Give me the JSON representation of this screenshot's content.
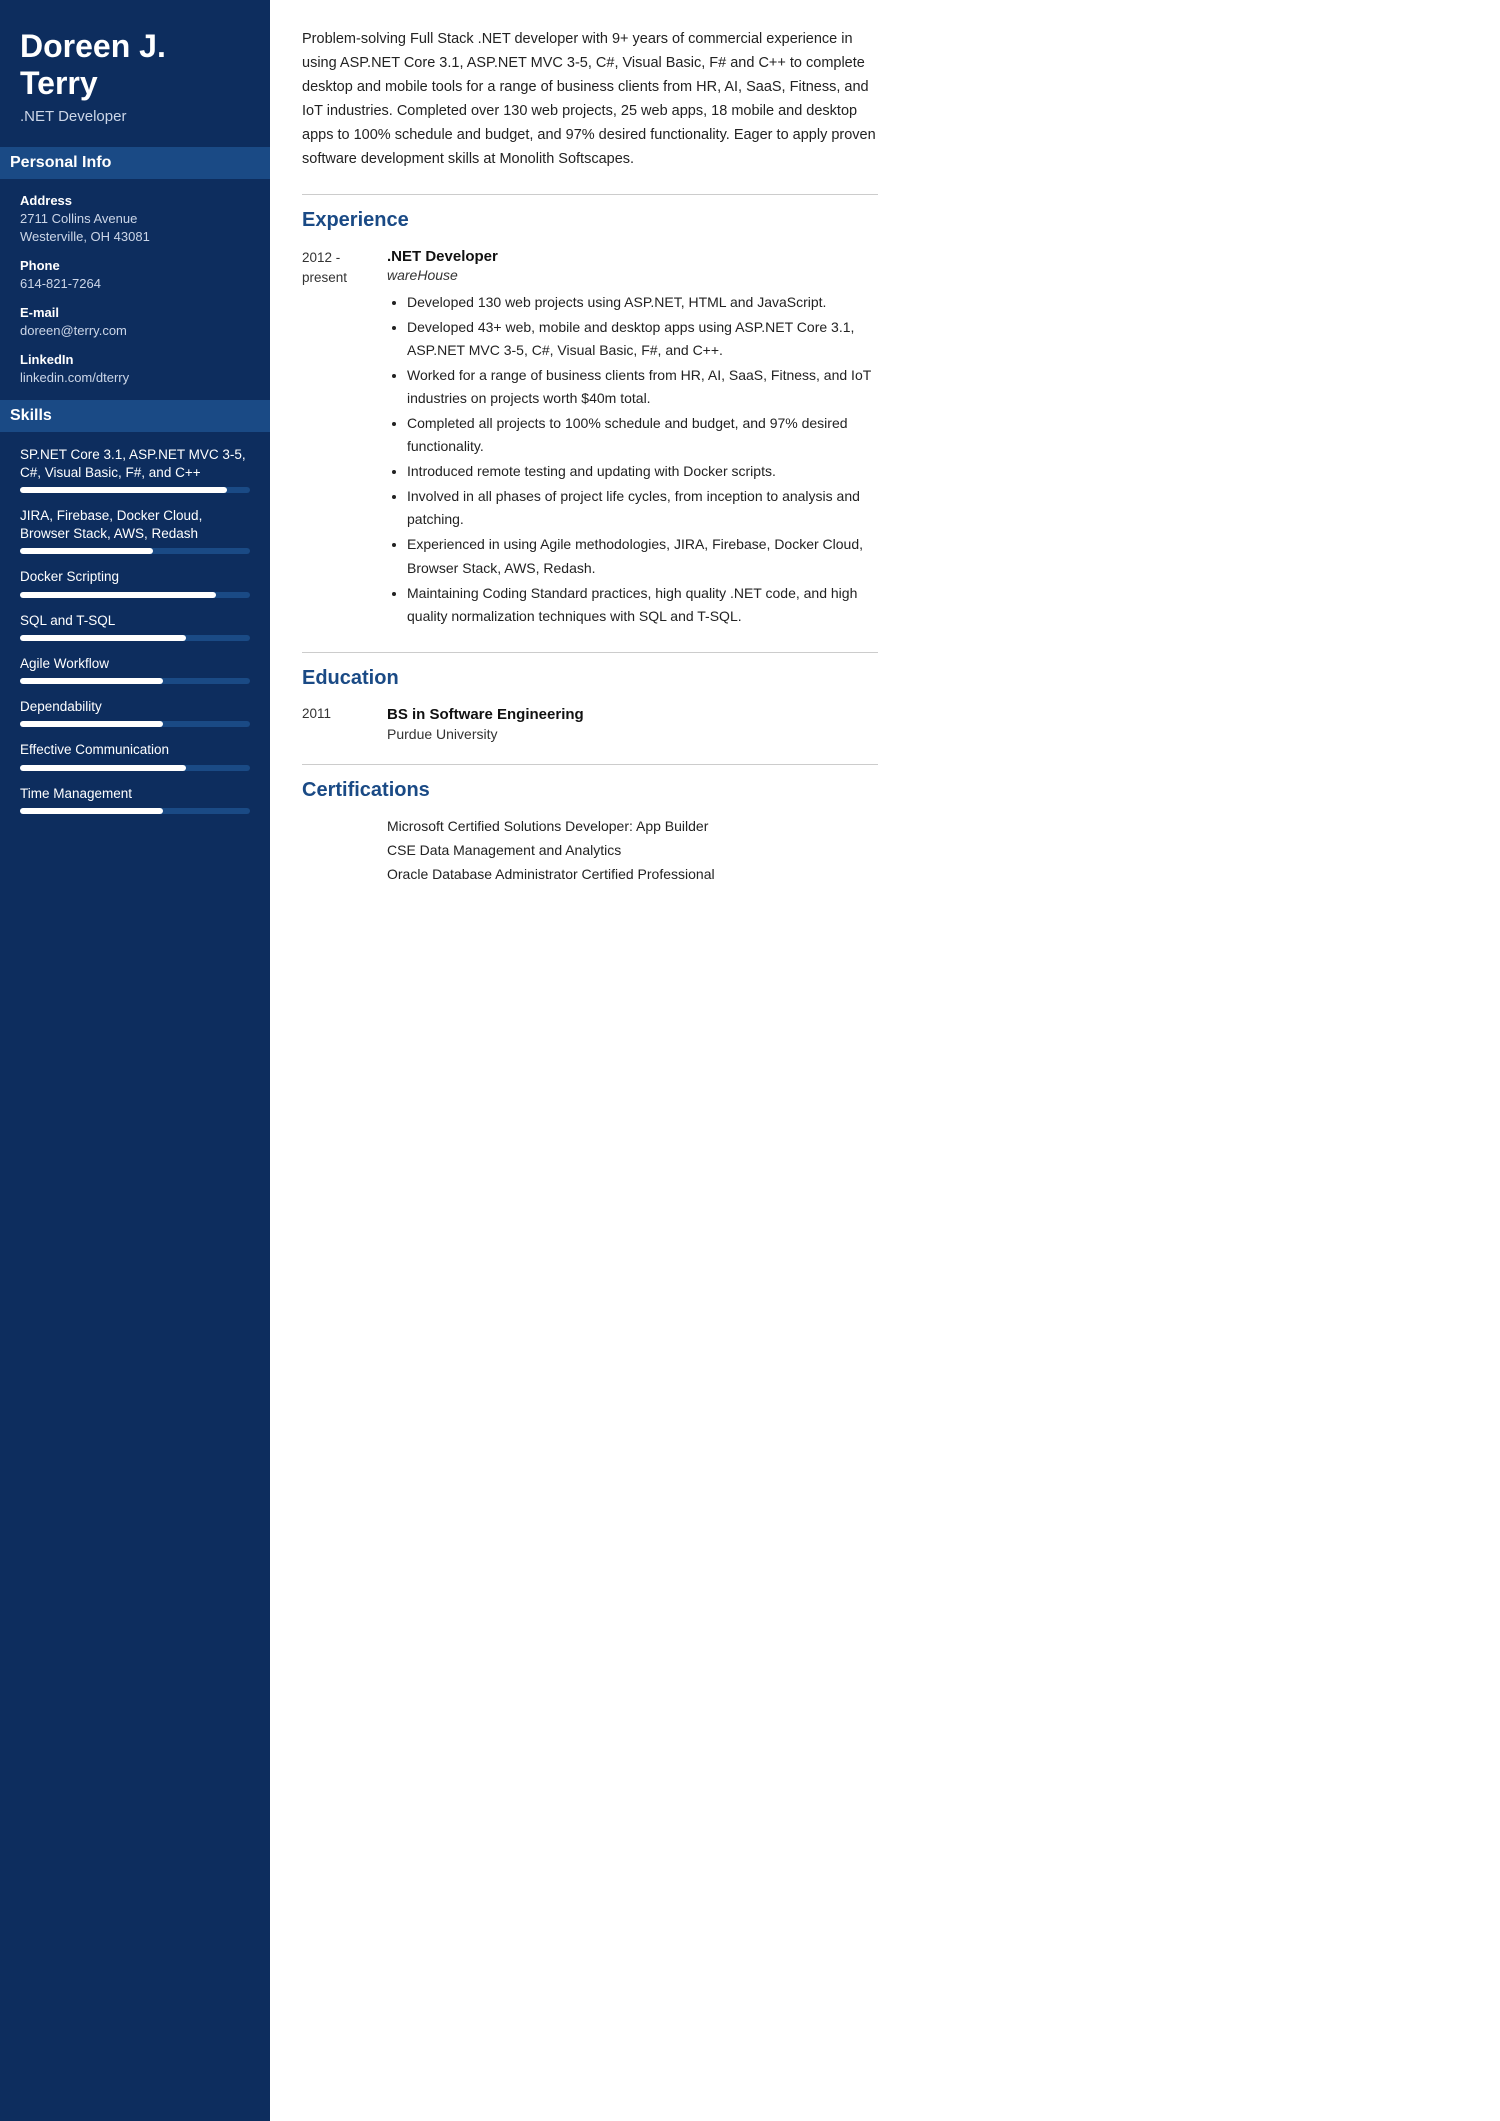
{
  "sidebar": {
    "name": "Doreen J. Terry",
    "title": ".NET Developer",
    "personal_info_header": "Personal Info",
    "personal_info": [
      {
        "label": "Address",
        "value": "2711 Collins Avenue\nWesterville, OH 43081"
      },
      {
        "label": "Phone",
        "value": "614-821-7264"
      },
      {
        "label": "E-mail",
        "value": "doreen@terry.com"
      },
      {
        "label": "LinkedIn",
        "value": "linkedin.com/dterry"
      }
    ],
    "skills_header": "Skills",
    "skills": [
      {
        "name": "SP.NET Core 3.1, ASP.NET MVC 3-5, C#, Visual Basic, F#, and C++",
        "fill_pct": 90
      },
      {
        "name": "JIRA, Firebase, Docker Cloud, Browser Stack, AWS, Redash",
        "fill_pct": 58
      },
      {
        "name": "Docker Scripting",
        "fill_pct": 85
      },
      {
        "name": "SQL and T-SQL",
        "fill_pct": 72
      },
      {
        "name": "Agile Workflow",
        "fill_pct": 62
      },
      {
        "name": "Dependability",
        "fill_pct": 62
      },
      {
        "name": "Effective Communication",
        "fill_pct": 72
      },
      {
        "name": "Time Management",
        "fill_pct": 62
      }
    ]
  },
  "main": {
    "summary": "Problem-solving Full Stack .NET developer with 9+ years of commercial experience in using ASP.NET Core 3.1, ASP.NET MVC 3-5, C#, Visual Basic, F# and C++ to complete desktop and mobile tools for a range of business clients from HR, AI, SaaS, Fitness, and IoT industries. Completed over 130 web projects, 25 web apps, 18 mobile and desktop apps to 100% schedule and budget, and 97% desired functionality. Eager to apply proven software development skills at Monolith Softscapes.",
    "experience_title": "Experience",
    "experience": [
      {
        "date": "2012 -\npresent",
        "job_title": ".NET Developer",
        "company": "wareHouse",
        "bullets": [
          "Developed 130 web projects using ASP.NET, HTML and JavaScript.",
          "Developed 43+ web, mobile and desktop apps using ASP.NET Core 3.1, ASP.NET MVC 3-5, C#, Visual Basic, F#, and C++.",
          "Worked for a range of business clients from HR, AI, SaaS, Fitness, and IoT industries on projects worth $40m total.",
          "Completed all projects to 100% schedule and budget, and 97% desired functionality.",
          "Introduced remote testing and updating with Docker scripts.",
          "Involved in all phases of project life cycles, from inception to analysis and patching.",
          "Experienced in using Agile methodologies, JIRA, Firebase, Docker Cloud, Browser Stack, AWS, Redash.",
          "Maintaining Coding Standard practices, high quality .NET code, and high quality normalization techniques with SQL and T-SQL."
        ]
      }
    ],
    "education_title": "Education",
    "education": [
      {
        "date": "2011",
        "degree": "BS in Software Engineering",
        "school": "Purdue University"
      }
    ],
    "certifications_title": "Certifications",
    "certifications": [
      {
        "name": "Microsoft Certified Solutions Developer: App Builder"
      },
      {
        "name": "CSE Data Management and Analytics"
      },
      {
        "name": "Oracle Database Administrator Certified Professional"
      }
    ]
  }
}
